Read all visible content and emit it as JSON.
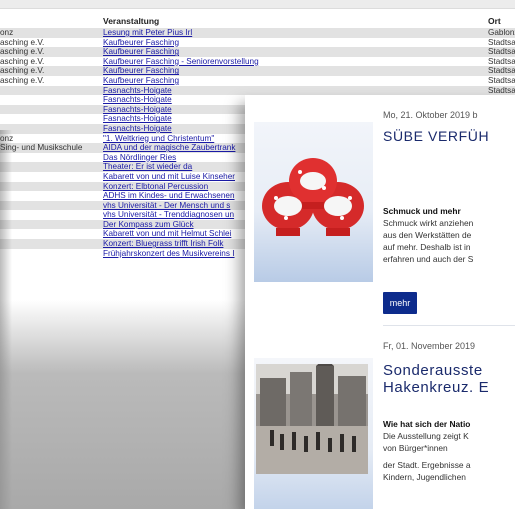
{
  "events_table": {
    "header": {
      "col1": "",
      "col2": "Veranstaltung",
      "col3": "Ort"
    },
    "rows": [
      {
        "organizer": "onz",
        "event": "Lesung mit Peter Pius Irl",
        "place": "Gablonzer Ha"
      },
      {
        "organizer": "asching e.V.",
        "event": "Kaufbeurer Fasching",
        "place": "Stadtsaal, Au"
      },
      {
        "organizer": "asching e.V.",
        "event": "Kaufbeurer Fasching",
        "place": "Stadtsaal, Au"
      },
      {
        "organizer": "asching e.V.",
        "event": "Kaufbeurer Fasching - Seniorenvorstellung",
        "place": "Stadtsaal, Au"
      },
      {
        "organizer": "asching e.V.",
        "event": "Kaufbeurer Fasching",
        "place": "Stadtsaal, Au"
      },
      {
        "organizer": "asching e.V.",
        "event": "Kaufbeurer Fasching",
        "place": "Stadtsaal, Au"
      },
      {
        "organizer": "",
        "event": "Fasnachts-Hoigate",
        "place": "Stadtsaal, Au"
      },
      {
        "organizer": "",
        "event": "Fasnachts-Hoigate",
        "place": ""
      },
      {
        "organizer": "",
        "event": "Fasnachts-Hoigate",
        "place": ""
      },
      {
        "organizer": "",
        "event": "Fasnachts-Hoigate",
        "place": ""
      },
      {
        "organizer": "",
        "event": "Fasnachts-Hoigate",
        "place": ""
      },
      {
        "organizer": "onz",
        "event": "\"1. Weltkrieg und Christentum\"",
        "place": ""
      },
      {
        "organizer": "Sing- und Musikschule",
        "event": "AIDA und der magische Zaubertrank",
        "place": ""
      },
      {
        "organizer": "",
        "event": "Das Nördlinger Ries",
        "place": ""
      },
      {
        "organizer": "",
        "event": "Theater: Er ist wieder da",
        "place": ""
      },
      {
        "organizer": "",
        "event": "Kabarett von und mit Luise Kinseher",
        "place": ""
      },
      {
        "organizer": "",
        "event": "Konzert: Elbtonal Percussion",
        "place": ""
      },
      {
        "organizer": "",
        "event": "ADHS im Kindes- und Erwachsenen",
        "place": ""
      },
      {
        "organizer": "",
        "event": "vhs Universität - Der Mensch und s",
        "place": ""
      },
      {
        "organizer": "",
        "event": "vhs Universität - Trenddiagnosen un",
        "place": ""
      },
      {
        "organizer": "",
        "event": "Der Kompass zum Glück",
        "place": ""
      },
      {
        "organizer": "",
        "event": "Kabarett von und mit Helmut Schlei",
        "place": ""
      },
      {
        "organizer": "",
        "event": "Konzert: Bluegrass trifft Irish Folk",
        "place": ""
      },
      {
        "organizer": "",
        "event": "Frühjahrskonzert des Musikvereins I",
        "place": ""
      }
    ]
  },
  "news": [
    {
      "date": "Mo, 21. Oktober 2019 b",
      "title": "SÜBE VERFÜH",
      "subheading": "Schmuck und mehr",
      "body_lines": [
        "Schmuck wirkt anziehen",
        "aus den Werkstätten de",
        "auf mehr. Deshalb ist in",
        "erfahren und auch der S"
      ],
      "button": "mehr",
      "image": "christmas-ornaments"
    },
    {
      "date": "Fr, 01. November 2019",
      "title_lines": [
        "Sonderausste",
        "Hakenkreuz. E"
      ],
      "subheading": "Wie hat sich der Natio",
      "body_lines": [
        "Die Ausstellung zeigt K",
        "von Bürger*innen"
      ],
      "body2_lines": [
        "der Stadt. Ergebnisse a",
        "Kindern, Jugendlichen"
      ],
      "image": "historic-parade-photo"
    }
  ],
  "colors": {
    "link": "#1a1aa6",
    "title": "#1a2a6c",
    "button": "#0d2b8c",
    "row_alt": "#e2e2e2"
  }
}
